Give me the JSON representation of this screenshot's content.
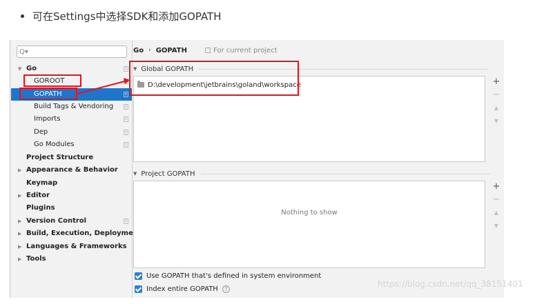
{
  "article": {
    "bullet_text": "可在Settings中选择SDK和添加GOPATH"
  },
  "sidebar": {
    "search_glyph": "Q▾",
    "items": [
      {
        "label": "Go",
        "bold": true,
        "expanded": true
      },
      {
        "label": "GOROOT"
      },
      {
        "label": "GOPATH",
        "selected": true
      },
      {
        "label": "Build Tags & Vendoring"
      },
      {
        "label": "Imports"
      },
      {
        "label": "Dep"
      },
      {
        "label": "Go Modules"
      },
      {
        "label": "Project Structure",
        "bold": true
      },
      {
        "label": "Appearance & Behavior",
        "bold": true
      },
      {
        "label": "Keymap",
        "bold": true
      },
      {
        "label": "Editor",
        "bold": true
      },
      {
        "label": "Plugins",
        "bold": true
      },
      {
        "label": "Version Control",
        "bold": true
      },
      {
        "label": "Build, Execution, Deployment",
        "bold": true
      },
      {
        "label": "Languages & Frameworks",
        "bold": true
      },
      {
        "label": "Tools",
        "bold": true
      }
    ]
  },
  "breadcrumb": {
    "root": "Go",
    "separator": "›",
    "current": "GOPATH",
    "scope": "For current project"
  },
  "global_gopath": {
    "title": "Global GOPATH",
    "paths": [
      "D:\\development\\jetbrains\\goland\\workspace"
    ]
  },
  "project_gopath": {
    "title": "Project GOPATH",
    "empty_text": "Nothing to show"
  },
  "tools": {
    "add": "+",
    "remove": "−",
    "up": "▲",
    "down": "▼"
  },
  "options": {
    "use_system_gopath": "Use GOPATH that's defined in system environment",
    "index_entire_gopath": "Index entire GOPATH",
    "help": "?"
  },
  "watermark": "https://blog.csdn.net/qq_38151401",
  "colors": {
    "selection": "#1f75cc",
    "annotation_red": "#e1141d",
    "checkbox": "#2f7fd6"
  }
}
